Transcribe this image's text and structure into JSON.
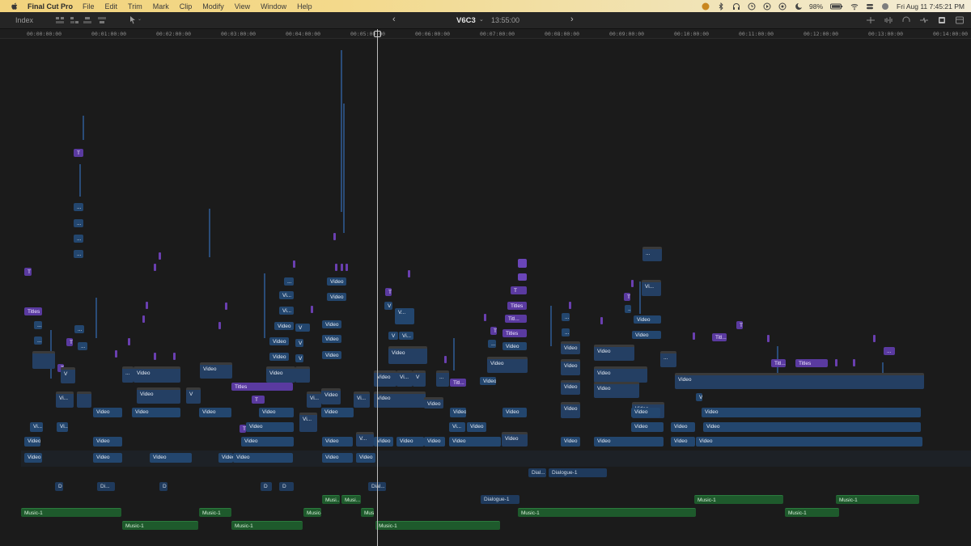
{
  "menubar": {
    "app_name": "Final Cut Pro",
    "menus": [
      "File",
      "Edit",
      "Trim",
      "Mark",
      "Clip",
      "Modify",
      "View",
      "Window",
      "Help"
    ],
    "battery": "98%",
    "datetime": "Fri Aug 11  7:45:21 PM"
  },
  "toolbar": {
    "index_label": "Index",
    "project_name": "V6C3",
    "duration": "13:55:00"
  },
  "ruler": {
    "labels": [
      "00:00:00:00",
      "00:01:00:00",
      "00:02:00:00",
      "00:03:00:00",
      "00:04:00:00",
      "00:05:00:00",
      "00:06:00:00",
      "00:07:00:00",
      "00:08:00:00",
      "00:09:00:00",
      "00:10:00:00",
      "00:11:00:00",
      "00:12:00:00",
      "00:13:00:00",
      "00:14:00:00"
    ]
  },
  "clips": {
    "video": "Video",
    "video_short": "Vi...",
    "v_short": "V...",
    "v": "V",
    "ellipsis": "...",
    "titles": "Titles",
    "titles_short": "Titl...",
    "t": "T",
    "dialogue": "Dialogue-1",
    "dialogue_short": "Di...",
    "dialogue_dia": "Dial...",
    "d": "D",
    "music": "Music-1",
    "music_short": "Musi..."
  }
}
